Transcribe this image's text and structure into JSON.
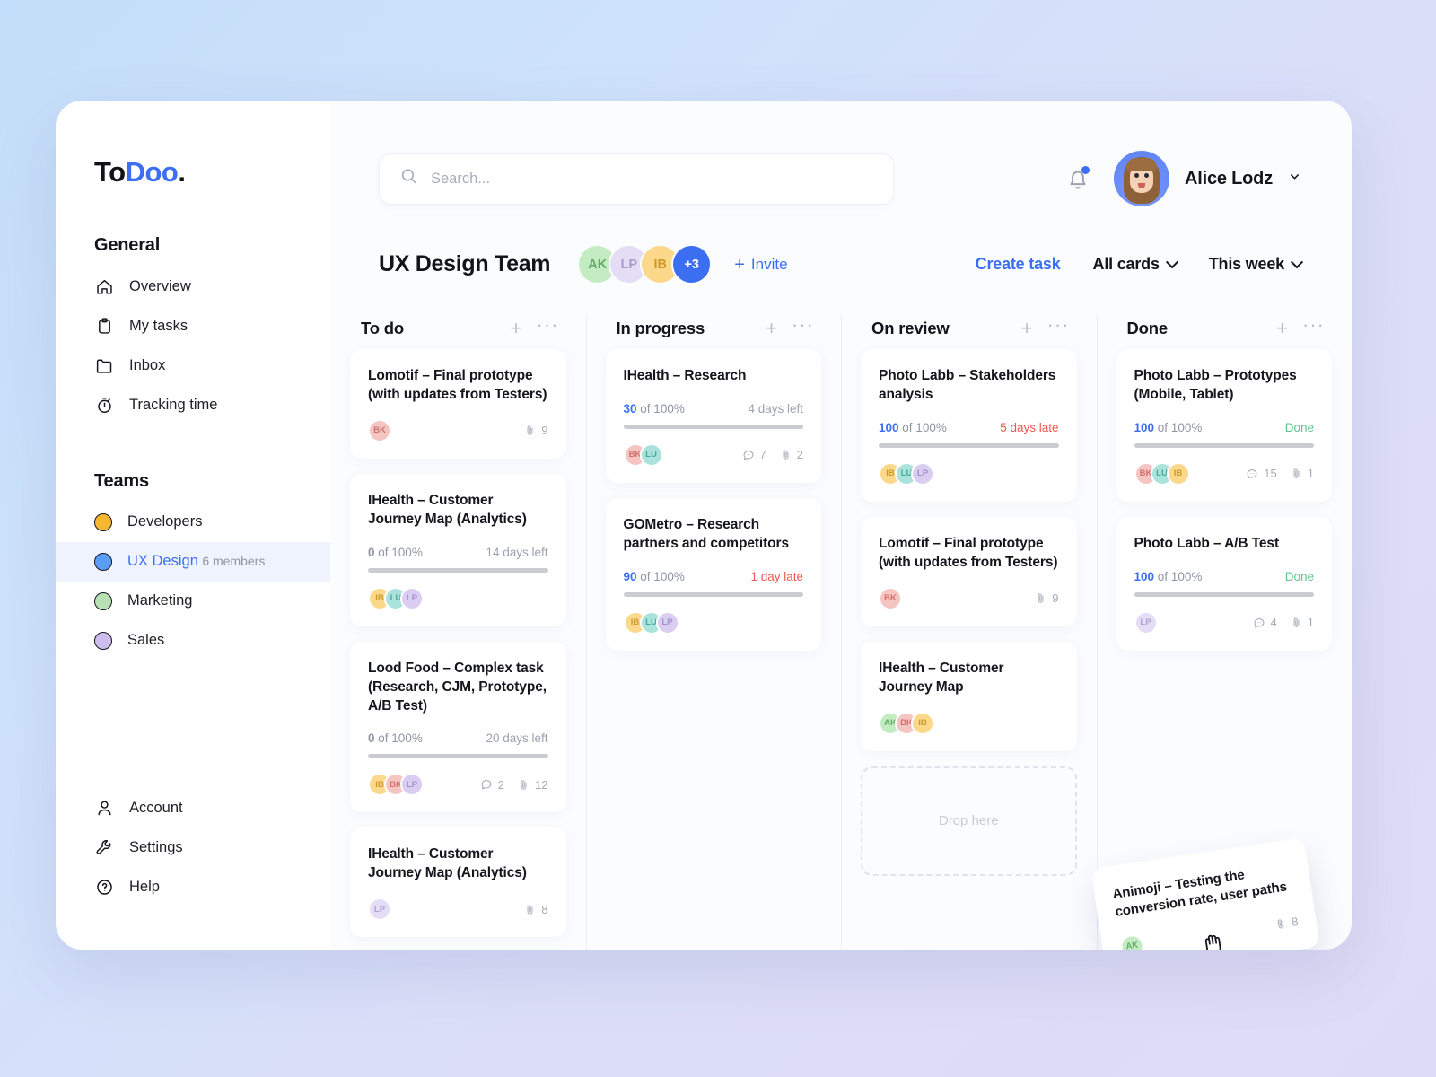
{
  "brand": {
    "name_dark": "To",
    "name_blue": "Doo",
    "dot": "."
  },
  "sidebar": {
    "general_label": "General",
    "nav": [
      {
        "label": "Overview",
        "icon": "home-icon"
      },
      {
        "label": "My tasks",
        "icon": "clipboard-icon"
      },
      {
        "label": "Inbox",
        "icon": "folder-icon"
      },
      {
        "label": "Tracking time",
        "icon": "stopwatch-icon"
      }
    ],
    "teams_label": "Teams",
    "teams": [
      {
        "label": "Developers",
        "color": "#f7b731",
        "sub": "",
        "active": false
      },
      {
        "label": "UX Design",
        "color": "#5a9df5",
        "sub": "6 members",
        "active": true
      },
      {
        "label": "Marketing",
        "color": "#b9e2b4",
        "sub": "",
        "active": false
      },
      {
        "label": "Sales",
        "color": "#cdbdec",
        "sub": "",
        "active": false
      }
    ],
    "bottom": [
      {
        "label": "Account",
        "icon": "person-icon"
      },
      {
        "label": "Settings",
        "icon": "wrench-icon"
      },
      {
        "label": "Help",
        "icon": "question-circle-icon"
      }
    ]
  },
  "search": {
    "placeholder": "Search...",
    "value": ""
  },
  "user": {
    "name": "Alice Lodz"
  },
  "board": {
    "title": "UX Design Team",
    "members": [
      {
        "initials": "AK",
        "bg": "#c4ecc3",
        "fg": "#63ab68"
      },
      {
        "initials": "LP",
        "bg": "#e4ddf6",
        "fg": "#a99ccd"
      },
      {
        "initials": "IB",
        "bg": "#fcd88a",
        "fg": "#cf9a2c"
      },
      {
        "initials": "+3",
        "bg": "#3b6ef0",
        "fg": "#ffffff"
      }
    ],
    "invite_label": "Invite",
    "create_task_label": "Create task",
    "filter_cards_label": "All cards",
    "filter_time_label": "This week"
  },
  "columns": [
    {
      "title": "To do",
      "cards": [
        {
          "title": "Lomotif – Final prototype (with updates from Testers)",
          "progress": null,
          "assignees": [
            {
              "initials": "BK",
              "bg": "#f5c5c2",
              "fg": "#d4706b"
            }
          ],
          "comments": null,
          "attachments": "9"
        },
        {
          "title": "IHealth – Customer Journey Map (Analytics)",
          "progress": {
            "value": "0",
            "of_label": "of 100%",
            "percent": 0,
            "due": "14 days left",
            "state": "normal"
          },
          "assignees": [
            {
              "initials": "IB",
              "bg": "#fcd88a",
              "fg": "#cf9a2c"
            },
            {
              "initials": "LU",
              "bg": "#a9e3dc",
              "fg": "#4da99c"
            },
            {
              "initials": "LP",
              "bg": "#d9cdf2",
              "fg": "#a291cc"
            }
          ],
          "comments": null,
          "attachments": null
        },
        {
          "title": "Lood Food – Complex task (Research, CJM, Prototype, A/B Test)",
          "progress": {
            "value": "0",
            "of_label": "of 100%",
            "percent": 0,
            "due": "20 days left",
            "state": "normal"
          },
          "assignees": [
            {
              "initials": "IB",
              "bg": "#fcd88a",
              "fg": "#cf9a2c"
            },
            {
              "initials": "BK",
              "bg": "#f5c5c2",
              "fg": "#d4706b"
            },
            {
              "initials": "LP",
              "bg": "#d9cdf2",
              "fg": "#a291cc"
            }
          ],
          "comments": "2",
          "attachments": "12"
        },
        {
          "title": "IHealth – Customer Journey Map (Analytics)",
          "progress": null,
          "assignees": [
            {
              "initials": "LP",
              "bg": "#e4ddf6",
              "fg": "#b0a2d4"
            }
          ],
          "comments": null,
          "attachments": "8"
        }
      ]
    },
    {
      "title": "In progress",
      "cards": [
        {
          "title": "IHealth – Research",
          "progress": {
            "value": "30",
            "of_label": "of 100%",
            "percent": 30,
            "due": "4 days left",
            "state": "normal"
          },
          "assignees": [
            {
              "initials": "BK",
              "bg": "#f5c5c2",
              "fg": "#d4706b"
            },
            {
              "initials": "LU",
              "bg": "#a9e3dc",
              "fg": "#4da99c"
            }
          ],
          "comments": "7",
          "attachments": "2"
        },
        {
          "title": "GOMetro – Research partners and competitors",
          "progress": {
            "value": "90",
            "of_label": "of 100%",
            "percent": 90,
            "due": "1 day late",
            "state": "late"
          },
          "assignees": [
            {
              "initials": "IB",
              "bg": "#fcd88a",
              "fg": "#cf9a2c"
            },
            {
              "initials": "LU",
              "bg": "#a9e3dc",
              "fg": "#4da99c"
            },
            {
              "initials": "LP",
              "bg": "#d9cdf2",
              "fg": "#a291cc"
            }
          ],
          "comments": null,
          "attachments": null
        }
      ]
    },
    {
      "title": "On review",
      "cards": [
        {
          "title": "Photo Labb – Stakeholders analysis",
          "progress": {
            "value": "100",
            "of_label": "of 100%",
            "percent": 100,
            "due": "5 days late",
            "state": "late"
          },
          "assignees": [
            {
              "initials": "IB",
              "bg": "#fcd88a",
              "fg": "#cf9a2c"
            },
            {
              "initials": "LU",
              "bg": "#a9e3dc",
              "fg": "#4da99c"
            },
            {
              "initials": "LP",
              "bg": "#d9cdf2",
              "fg": "#a291cc"
            }
          ],
          "comments": null,
          "attachments": null
        },
        {
          "title": "Lomotif – Final prototype (with updates from Testers)",
          "progress": null,
          "assignees": [
            {
              "initials": "BK",
              "bg": "#f5c5c2",
              "fg": "#d4706b"
            }
          ],
          "comments": null,
          "attachments": "9"
        },
        {
          "title": "IHealth – Customer Journey Map",
          "progress": null,
          "assignees": [
            {
              "initials": "AK",
              "bg": "#c4ecc3",
              "fg": "#63ab68"
            },
            {
              "initials": "BK",
              "bg": "#f5c5c2",
              "fg": "#d4706b"
            },
            {
              "initials": "IB",
              "bg": "#fcd88a",
              "fg": "#cf9a2c"
            }
          ],
          "comments": null,
          "attachments": null
        }
      ],
      "dropzone_label": "Drop here"
    },
    {
      "title": "Done",
      "cards": [
        {
          "title": "Photo Labb – Prototypes (Mobile, Tablet)",
          "progress": {
            "value": "100",
            "of_label": "of 100%",
            "percent": 100,
            "due": "Done",
            "state": "done"
          },
          "assignees": [
            {
              "initials": "BK",
              "bg": "#f5c5c2",
              "fg": "#d4706b"
            },
            {
              "initials": "LU",
              "bg": "#a9e3dc",
              "fg": "#4da99c"
            },
            {
              "initials": "IB",
              "bg": "#fcd88a",
              "fg": "#cf9a2c"
            }
          ],
          "comments": "15",
          "attachments": "1"
        },
        {
          "title": "Photo Labb – A/B Test",
          "progress": {
            "value": "100",
            "of_label": "of 100%",
            "percent": 100,
            "due": "Done",
            "state": "done"
          },
          "assignees": [
            {
              "initials": "LP",
              "bg": "#e4ddf6",
              "fg": "#b0a2d4"
            }
          ],
          "comments": "4",
          "attachments": "1"
        }
      ]
    }
  ],
  "dragging_card": {
    "title": "Animoji – Testing the conversion rate, user paths",
    "assignees": [
      {
        "initials": "AK",
        "bg": "#c4ecc3",
        "fg": "#63ab68"
      }
    ],
    "attachments": "8"
  },
  "colors": {
    "accent": "#3b6ef0",
    "late": "#f0584f",
    "done": "#62c38a"
  }
}
